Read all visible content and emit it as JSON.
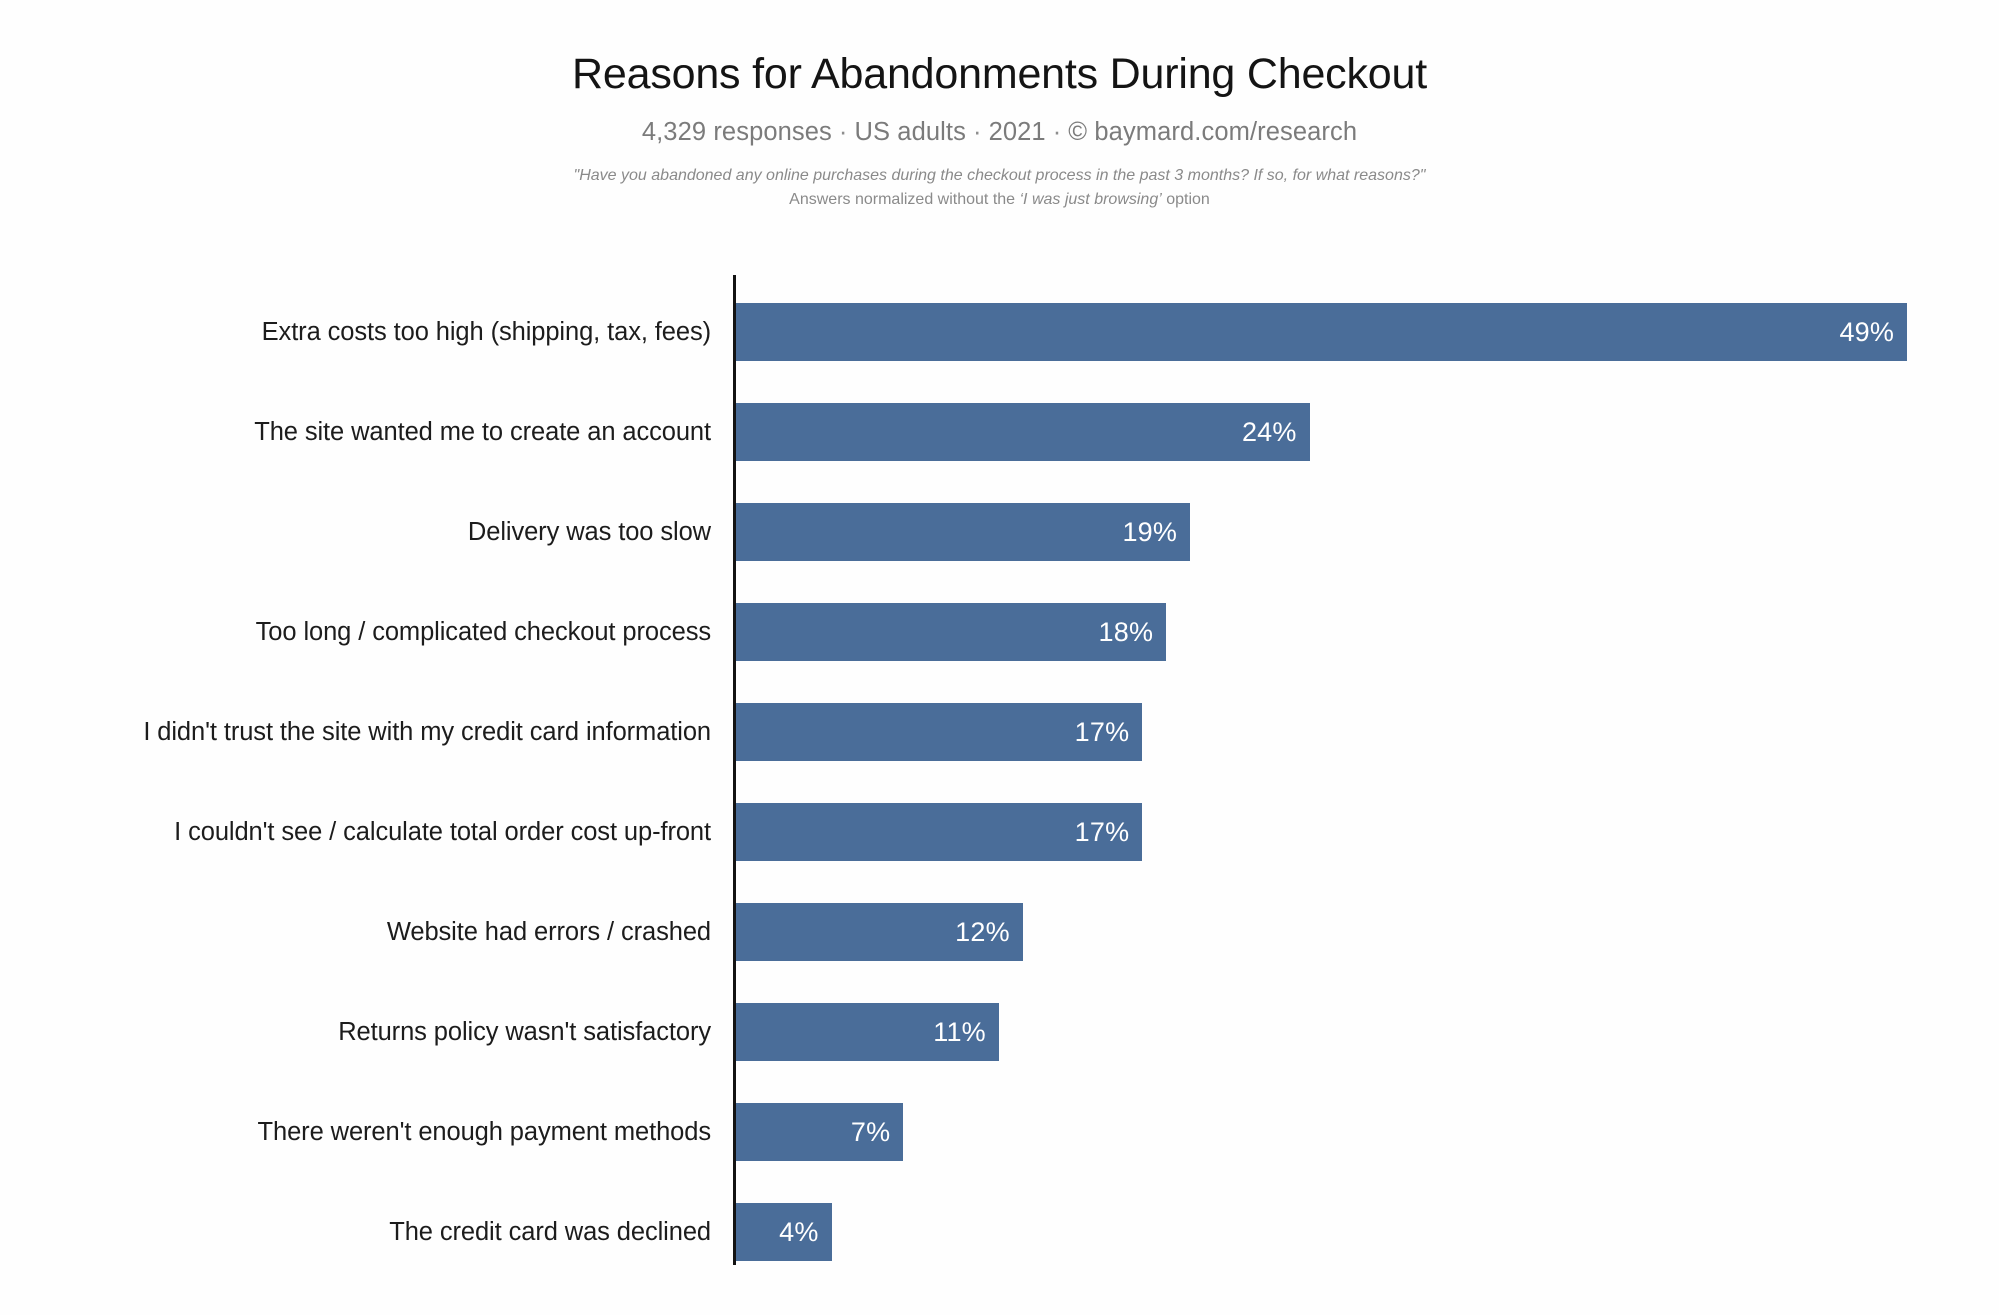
{
  "header": {
    "title": "Reasons for Abandonments During Checkout",
    "source": {
      "responses": "4,329 responses",
      "population": "US adults",
      "year": "2021",
      "copyright": "©",
      "attribution": "baymard.com/research",
      "separator": "·"
    },
    "note_line1": "\"Have you abandoned any online purchases during the checkout process in the past 3 months? If so, for what reasons?\"",
    "note_line2_prefix": "Answers normalized without the ",
    "note_line2_option": "‘I was just browsing’",
    "note_line2_suffix": " option"
  },
  "colors": {
    "bar": "#4a6d99",
    "axis": "#131313",
    "title_text": "#141414",
    "source_text": "#7b7b7b",
    "note_text": "#8a8a8a",
    "value_text": "#ffffff",
    "background": "#fefefe"
  },
  "chart_data": {
    "type": "bar",
    "orientation": "horizontal",
    "title": "Reasons for Abandonments During Checkout",
    "subtitle": "4,329 responses · US adults · 2021 · © baymard.com/research",
    "xlabel": "",
    "ylabel": "",
    "xlim": [
      0,
      49
    ],
    "grid": false,
    "legend": null,
    "value_suffix": "%",
    "categories": [
      "Extra costs too high (shipping, tax, fees)",
      "The site wanted me to create an account",
      "Delivery was too slow",
      "Too long / complicated checkout process",
      "I didn't trust the site with my credit card information",
      "I couldn't see / calculate total order cost up-front",
      "Website had errors / crashed",
      "Returns policy wasn't satisfactory",
      "There weren't enough payment methods",
      "The credit card was declined"
    ],
    "values": [
      49,
      24,
      19,
      18,
      17,
      17,
      12,
      11,
      7,
      4
    ],
    "value_labels": [
      "49%",
      "24%",
      "19%",
      "18%",
      "17%",
      "17%",
      "12%",
      "11%",
      "7%",
      "4%"
    ]
  }
}
